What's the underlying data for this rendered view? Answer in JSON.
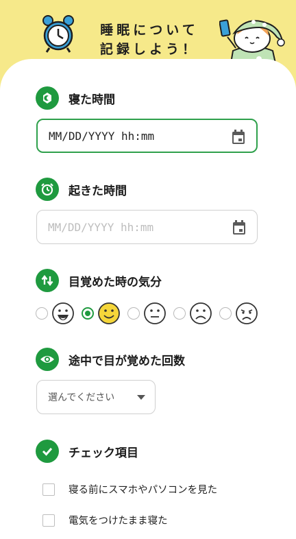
{
  "header": {
    "title_line1": "睡眠について",
    "title_line2": "記録しよう！"
  },
  "colors": {
    "accent": "#1f9a3f",
    "header_bg": "#f6e98a",
    "selected_face": "#f5d63a"
  },
  "sleep_time": {
    "label": "寝た時間",
    "icon": "moon-icon",
    "placeholder": "MM/DD/YYYY hh:mm"
  },
  "wake_time": {
    "label": "起きた時間",
    "icon": "alarm-clock-icon",
    "placeholder": "MM/DD/YYYY hh:mm"
  },
  "mood": {
    "label": "目覚めた時の気分",
    "icon": "swap-arrows-icon",
    "options": [
      "very-happy",
      "happy",
      "neutral",
      "sad",
      "very-sad"
    ],
    "selected": "happy"
  },
  "wakeups": {
    "label": "途中で目が覚めた回数",
    "icon": "eye-icon",
    "placeholder": "選んでください"
  },
  "checklist": {
    "label": "チェック項目",
    "icon": "check-icon",
    "items": [
      {
        "label": "寝る前にスマホやパソコンを見た",
        "checked": false
      },
      {
        "label": "電気をつけたまま寝た",
        "checked": false
      }
    ]
  }
}
